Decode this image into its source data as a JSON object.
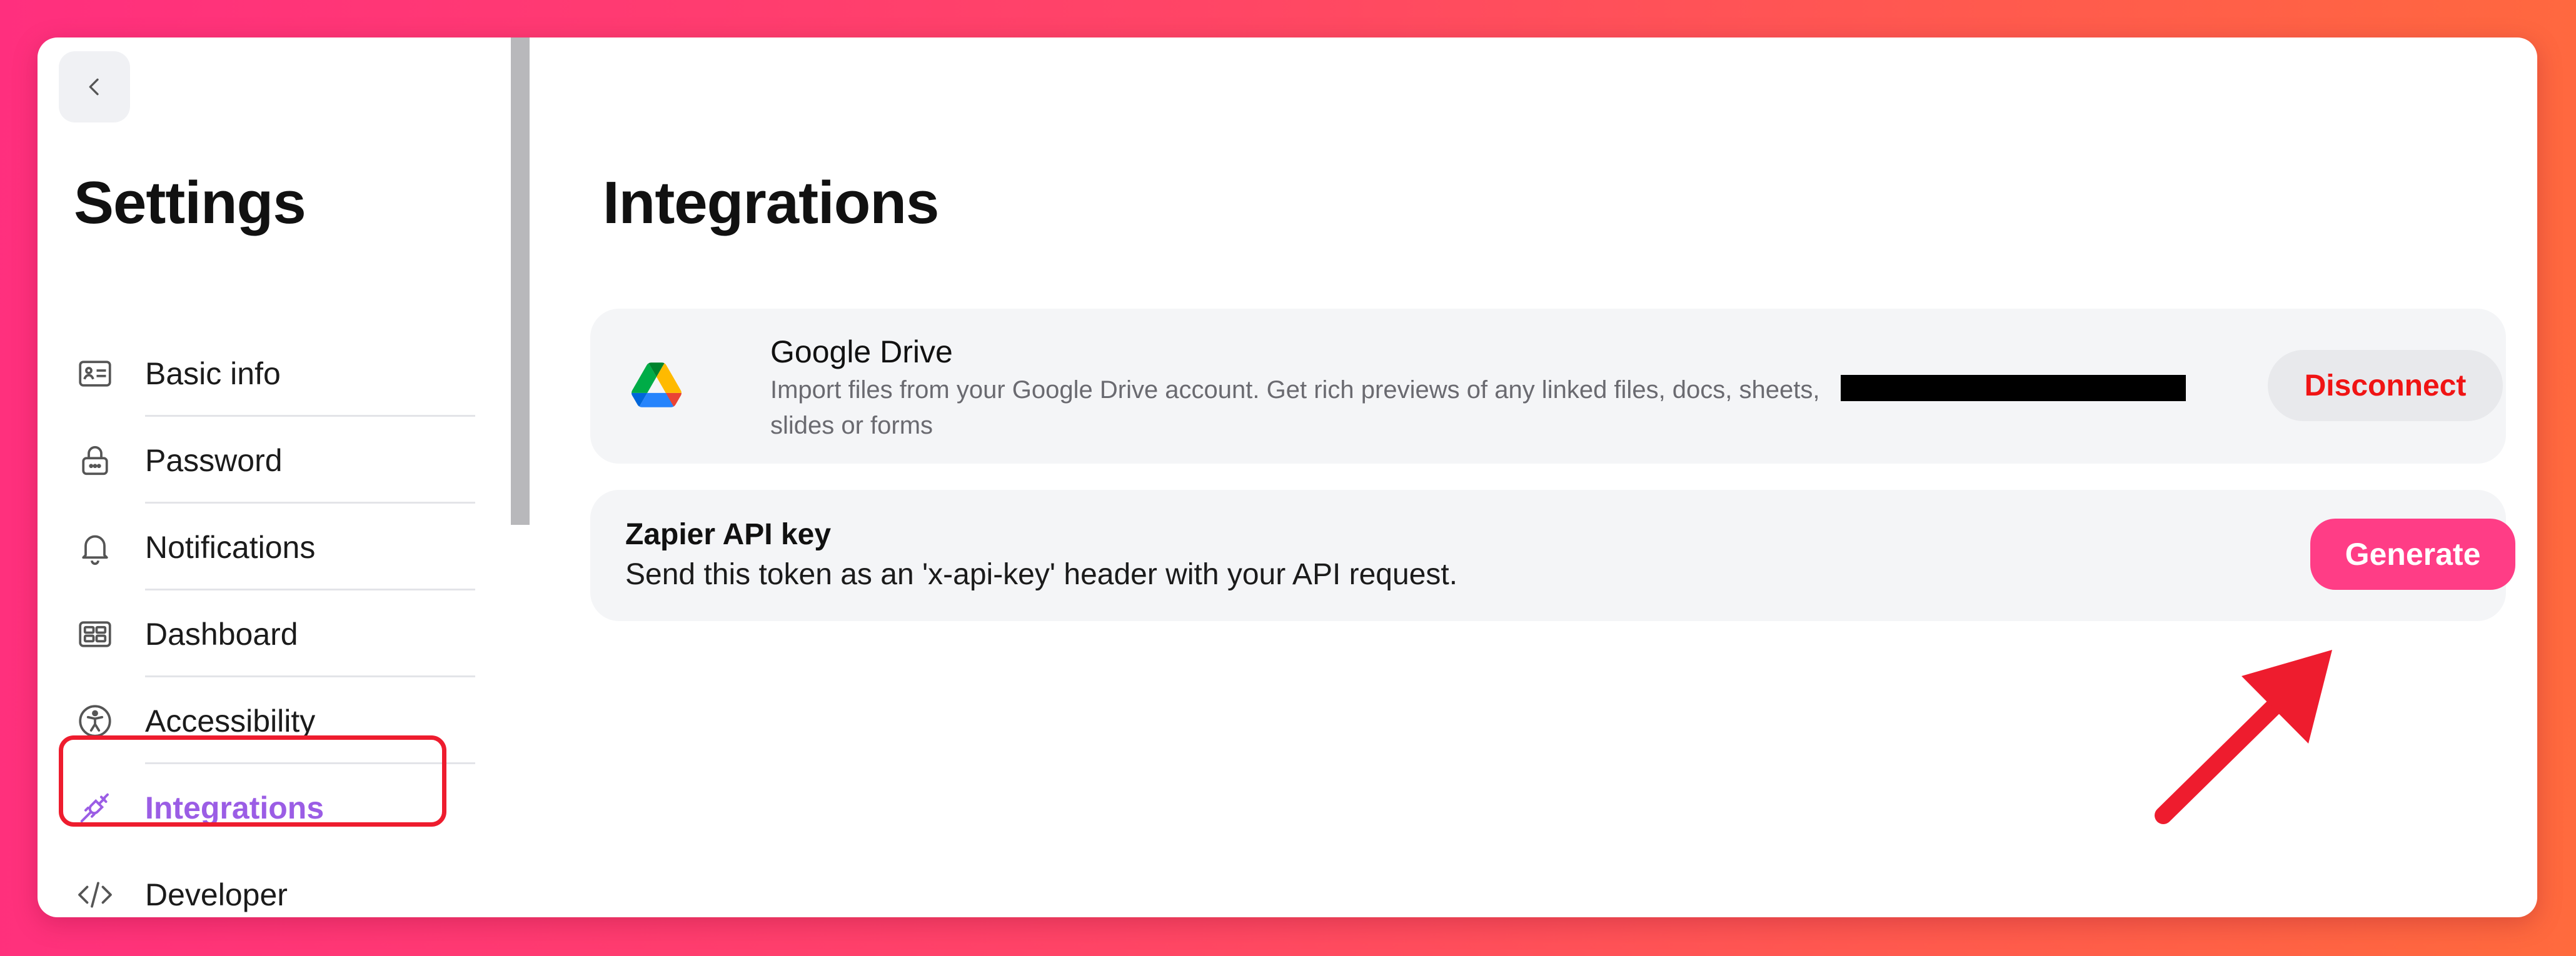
{
  "sidebar": {
    "title": "Settings",
    "items": [
      {
        "label": "Basic info"
      },
      {
        "label": "Password"
      },
      {
        "label": "Notifications"
      },
      {
        "label": "Dashboard"
      },
      {
        "label": "Accessibility"
      },
      {
        "label": "Integrations",
        "active": true
      },
      {
        "label": "Developer"
      }
    ]
  },
  "main": {
    "title": "Integrations",
    "google_drive": {
      "name": "Google Drive",
      "description": "Import files from your Google Drive account. Get rich previews of any linked files, docs, sheets, slides or forms",
      "disconnect_label": "Disconnect"
    },
    "zapier": {
      "title": "Zapier API key",
      "description": "Send this token as an 'x-api-key' header with your API request.",
      "generate_label": "Generate"
    }
  },
  "colors": {
    "accent_active": "#9b5de5",
    "generate_button": "#ff3d86",
    "disconnect_text": "#f01414",
    "highlight_box": "#ee1c2e"
  }
}
